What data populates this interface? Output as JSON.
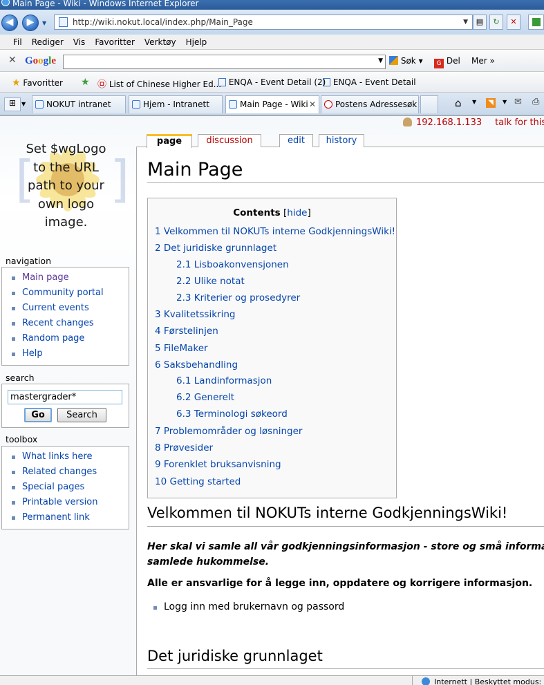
{
  "window": {
    "title": "Main Page - Wiki - Windows Internet Explorer"
  },
  "address": {
    "url": "http://wiki.nokut.local/index.php/Main_Page"
  },
  "menubar": {
    "items": [
      "Fil",
      "Rediger",
      "Vis",
      "Favoritter",
      "Verktøy",
      "Hjelp"
    ]
  },
  "googlebar": {
    "logo": "Google",
    "search_label": "Søk",
    "share_label": "Del",
    "more_label": "Mer »"
  },
  "favbar": {
    "favorites_label": "Favoritter",
    "links": [
      "List of Chinese Higher Ed...",
      "ENQA - Event Detail (2)",
      "ENQA - Event Detail"
    ]
  },
  "tabs": [
    {
      "label": "NOKUT intranet"
    },
    {
      "label": "Hjem - Intranett"
    },
    {
      "label": "Main Page - Wiki",
      "active": true
    },
    {
      "label": "Postens Adressesøk"
    }
  ],
  "userbar": {
    "ip": "192.168.1.133",
    "talk": "talk for this"
  },
  "logo": {
    "lines": [
      "Set $wgLogo",
      "to the URL",
      "path to your",
      "own logo",
      "image."
    ]
  },
  "sidebar": {
    "navigation_title": "navigation",
    "navigation": [
      "Main page",
      "Community portal",
      "Current events",
      "Recent changes",
      "Random page",
      "Help"
    ],
    "search_title": "search",
    "search_value": "mastergrader*",
    "go_label": "Go",
    "search_label": "Search",
    "toolbox_title": "toolbox",
    "toolbox": [
      "What links here",
      "Related changes",
      "Special pages",
      "Printable version",
      "Permanent link"
    ]
  },
  "content_tabs": [
    "page",
    "discussion",
    "edit",
    "history"
  ],
  "page": {
    "title": "Main Page",
    "toc_title": "Contents",
    "toc_hide": "hide",
    "toc": [
      {
        "num": "1",
        "text": "Velkommen til NOKUTs interne GodkjenningsWiki!",
        "level": 1
      },
      {
        "num": "2",
        "text": "Det juridiske grunnlaget",
        "level": 1
      },
      {
        "num": "2.1",
        "text": "Lisboakonvensjonen",
        "level": 2
      },
      {
        "num": "2.2",
        "text": "Ulike notat",
        "level": 2
      },
      {
        "num": "2.3",
        "text": "Kriterier og prosedyrer",
        "level": 2
      },
      {
        "num": "3",
        "text": "Kvalitetssikring",
        "level": 1
      },
      {
        "num": "4",
        "text": "Førstelinjen",
        "level": 1
      },
      {
        "num": "5",
        "text": "FileMaker",
        "level": 1
      },
      {
        "num": "6",
        "text": "Saksbehandling",
        "level": 1
      },
      {
        "num": "6.1",
        "text": "Landinformasjon",
        "level": 2
      },
      {
        "num": "6.2",
        "text": "Generelt",
        "level": 2
      },
      {
        "num": "6.3",
        "text": "Terminologi søkeord",
        "level": 2
      },
      {
        "num": "7",
        "text": "Problemområder og løsninger",
        "level": 1
      },
      {
        "num": "8",
        "text": "Prøvesider",
        "level": 1
      },
      {
        "num": "9",
        "text": "Forenklet bruksanvisning",
        "level": 1
      },
      {
        "num": "10",
        "text": "Getting started",
        "level": 1
      }
    ],
    "h_welcome": "Velkommen til NOKUTs interne GodkjenningsWiki!",
    "intro_line1": "Her skal vi samle all vår godkjenningsinformasjon - store og små informasjon",
    "intro_line2": "samlede hukommelse.",
    "responsibility": "Alle er ansvarlige for å legge inn, oppdatere og korrigere informasjon.",
    "bullet": "Logg inn med brukernavn og passord",
    "h_juridisk": "Det juridiske grunnlaget"
  },
  "statusbar": {
    "text": "Internett | Beskyttet modus: På"
  }
}
